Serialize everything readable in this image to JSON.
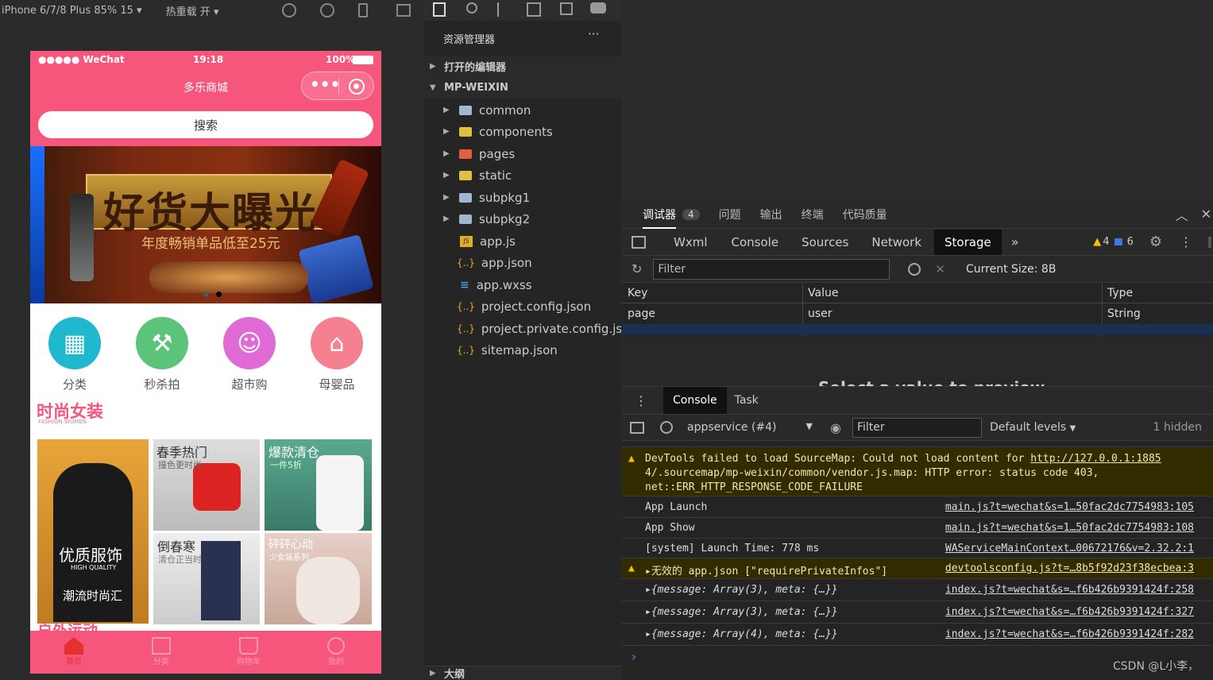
{
  "simulator": {
    "device": "iPhone 6/7/8 Plus 85% 15",
    "hot_reload": "热重载 开",
    "status": {
      "carrier": "●●●●● WeChat",
      "time": "19:18",
      "battery": "100%"
    },
    "nav_title": "多乐商城",
    "search_placeholder": "搜索",
    "banner_title": "好货大曝光",
    "banner_subtitle": "年度畅销单品低至25元",
    "categories": [
      {
        "label": "分类",
        "color": "#1fb8cf"
      },
      {
        "label": "秒杀拍",
        "color": "#5cc47a"
      },
      {
        "label": "超市购",
        "color": "#e06bd7"
      },
      {
        "label": "母婴品",
        "color": "#f5808f"
      }
    ],
    "section_title": "时尚女装",
    "section_sub": "FASHION WOMEN",
    "products": [
      {
        "title": "优质服饰",
        "sub": "HIGH QUALITY",
        "tag": "潮流时尚汇"
      },
      {
        "title": "春季热门",
        "sub": "撞色更时尚"
      },
      {
        "title": "爆款清仓",
        "sub": "一件5折"
      },
      {
        "title": "倒春寒",
        "sub": "清仓正当时"
      },
      {
        "title": "砰砰心动",
        "sub": "少女装系列"
      }
    ],
    "next_section": "户外运动",
    "tabs": [
      "首页",
      "分类",
      "购物车",
      "我的"
    ]
  },
  "explorer": {
    "title": "资源管理器",
    "more": "···",
    "open_editors": "打开的编辑器",
    "project": "MP-WEIXIN",
    "folders": [
      "common",
      "components",
      "pages",
      "static",
      "subpkg1",
      "subpkg2"
    ],
    "files": [
      {
        "name": "app.js",
        "icon": "JS"
      },
      {
        "name": "app.json",
        "icon": "{..}"
      },
      {
        "name": "app.wxss",
        "icon": "≡"
      },
      {
        "name": "project.config.json",
        "icon": "{..}"
      },
      {
        "name": "project.private.config.js...",
        "icon": "{..}"
      },
      {
        "name": "sitemap.json",
        "icon": "{..}"
      }
    ],
    "outline": "大纲"
  },
  "devtools": {
    "top_tabs": [
      "调试器",
      "问题",
      "输出",
      "终端",
      "代码质量"
    ],
    "debugger_badge": "4",
    "panel_tabs": [
      "Wxml",
      "Console",
      "Sources",
      "Network",
      "Storage"
    ],
    "active_panel": "Storage",
    "warn_count": "4",
    "info_count": "6",
    "filter_placeholder": "Filter",
    "current_size": "Current Size: 8B",
    "storage_columns": [
      "Key",
      "Value",
      "Type"
    ],
    "storage_rows": [
      {
        "key": "page",
        "value": "user",
        "type": "String"
      }
    ],
    "preview_text": "Select a value to preview",
    "console_tabs": [
      "Console",
      "Task"
    ],
    "context": "appservice (#4)",
    "default_levels": "Default levels",
    "hidden": "1 hidden",
    "logs": [
      {
        "level": "warn",
        "lines": [
          "DevTools failed to load SourceMap: Could not load content for ",
          "4/.sourcemap/mp-weixin/common/vendor.js.map: HTTP error: status code 403,",
          "net::ERR_HTTP_RESPONSE_CODE_FAILURE"
        ],
        "link": "http://127.0.0.1:1885"
      },
      {
        "level": "log",
        "text": "App Launch",
        "source": "main.js?t=wechat&s=1…50fac2dc7754983:105"
      },
      {
        "level": "log",
        "text": "App Show",
        "source": "main.js?t=wechat&s=1…50fac2dc7754983:108"
      },
      {
        "level": "log",
        "text": "[system] Launch Time: 778 ms",
        "source": "WAServiceMainContext…00672176&v=2.32.2:1"
      },
      {
        "level": "warn",
        "text": "▸无效的 app.json [\"requirePrivateInfos\"]",
        "source": "devtoolsconfig.js?t=…8b5f92d23f38ecbea:3"
      },
      {
        "level": "log",
        "text": "▸{message: Array(3), meta: {…}}",
        "source": "index.js?t=wechat&s=…f6b426b9391424f:258"
      },
      {
        "level": "log",
        "text": "▸{message: Array(3), meta: {…}}",
        "source": "index.js?t=wechat&s=…f6b426b9391424f:327"
      },
      {
        "level": "log",
        "text": "▸{message: Array(4), meta: {…}}",
        "source": "index.js?t=wechat&s=…f6b426b9391424f:282"
      }
    ],
    "prompt": "›",
    "watermark": "CSDN @L小李，"
  }
}
